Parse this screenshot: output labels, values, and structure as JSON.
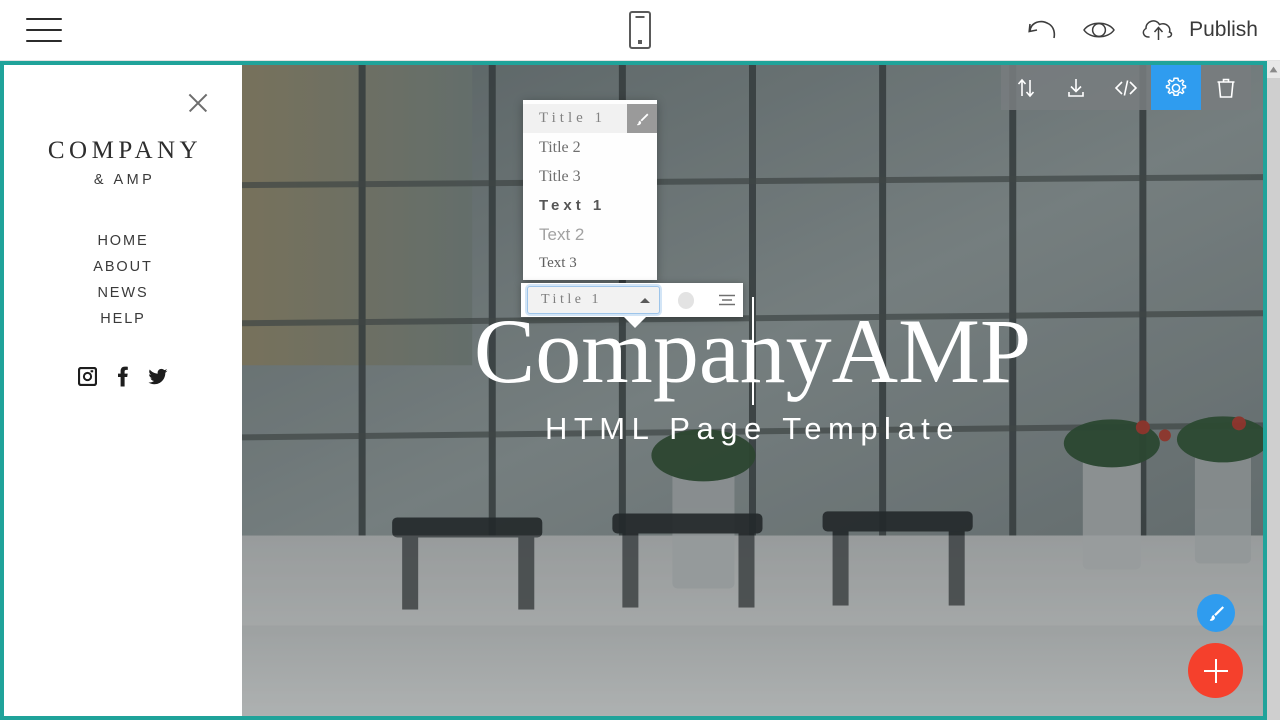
{
  "topbar": {
    "menu_icon": "hamburger-icon",
    "preview_device_icon": "mobile-phone-icon",
    "undo_icon": "undo-arrow-icon",
    "preview_icon": "eye-icon",
    "publish_icon": "cloud-upload-icon",
    "publish_label": "Publish"
  },
  "sidepanel": {
    "close_icon": "close-x-icon",
    "brand_main": "COMPANY",
    "brand_sub": "& AMP",
    "nav": [
      {
        "label": "HOME"
      },
      {
        "label": "ABOUT"
      },
      {
        "label": "NEWS"
      },
      {
        "label": "HELP"
      }
    ],
    "social": [
      {
        "name": "instagram-icon"
      },
      {
        "name": "facebook-icon"
      },
      {
        "name": "twitter-icon"
      }
    ]
  },
  "hero": {
    "title": "CompanyAMP",
    "subtitle": "HTML Page Template"
  },
  "section_toolbar": {
    "buttons": [
      {
        "name": "move-section-button",
        "icon": "up-down-arrows-icon",
        "active": false
      },
      {
        "name": "download-section-button",
        "icon": "download-icon",
        "active": false
      },
      {
        "name": "edit-code-button",
        "icon": "code-brackets-icon",
        "active": false
      },
      {
        "name": "section-settings-button",
        "icon": "gear-icon",
        "active": true
      },
      {
        "name": "delete-section-button",
        "icon": "trash-icon",
        "active": false
      }
    ],
    "active_color": "#2f9cef",
    "background_color": "#787c7e"
  },
  "style_popover": {
    "options": [
      {
        "label": "Title 1",
        "style": "sty-t1",
        "selected": true,
        "brush_icon": "brush-icon"
      },
      {
        "label": "Title 2",
        "style": "sty-t2",
        "selected": false
      },
      {
        "label": "Title 3",
        "style": "sty-t3",
        "selected": false
      },
      {
        "label": "Text 1",
        "style": "sty-x1",
        "selected": false
      },
      {
        "label": "Text 2",
        "style": "sty-x2",
        "selected": false
      },
      {
        "label": "Text 3",
        "style": "sty-x3",
        "selected": false
      }
    ]
  },
  "edit_toolbar": {
    "selected_style": "Title 1",
    "caret_icon": "chevron-up-icon",
    "color_swatch": "#e3e3e3",
    "align_icon": "align-center-icon"
  },
  "fabs": {
    "brush": {
      "icon": "brush-icon",
      "color": "#2f9cef"
    },
    "add": {
      "icon": "plus-icon",
      "color": "#f5402c"
    }
  },
  "scrollbar": {
    "up_arrow_icon": "scroll-up-arrow-icon"
  },
  "theme": {
    "accent_teal": "#20a39a",
    "accent_blue": "#2f9cef",
    "accent_red": "#f5402c"
  }
}
